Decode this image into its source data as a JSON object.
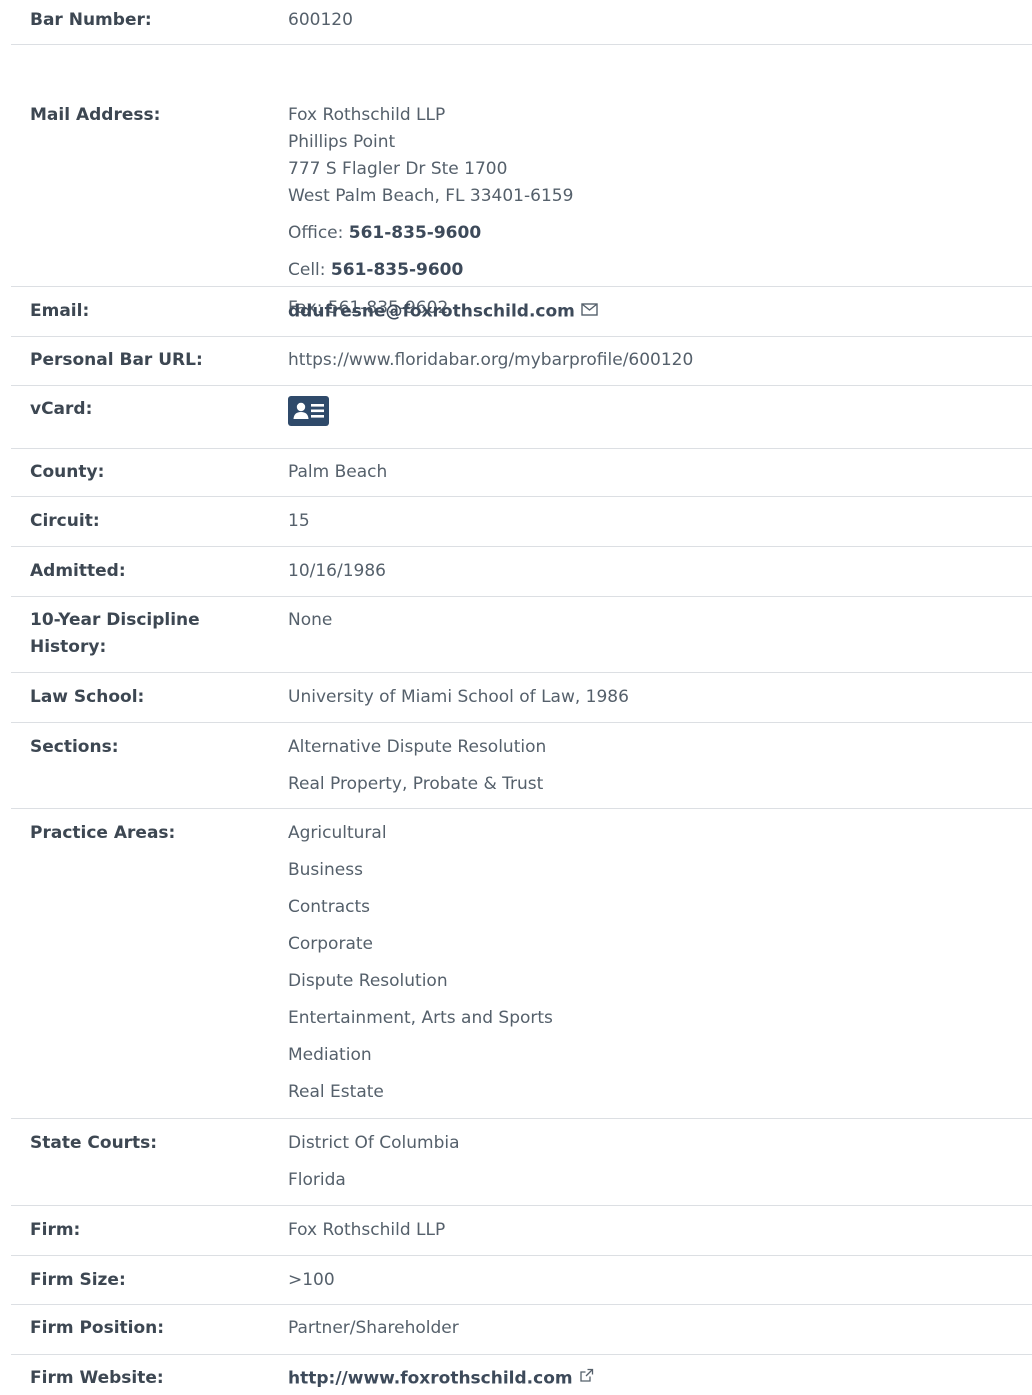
{
  "bar_number": {
    "label": "Bar Number:",
    "value": "600120"
  },
  "mail_address": {
    "label": "Mail Address:",
    "lines": [
      "Fox Rothschild LLP",
      "Phillips Point",
      "777 S Flagler Dr Ste 1700",
      "West Palm Beach, FL 33401-6159"
    ],
    "office_label": "Office: ",
    "office_phone": "561-835-9600",
    "cell_label": "Cell: ",
    "cell_phone": "561-835-9600",
    "fax_label": "Fax: ",
    "fax": "561-835-9602"
  },
  "email": {
    "label": "Email:",
    "value": "ddufresne@foxrothschild.com",
    "icon": "envelope-icon"
  },
  "personal_url": {
    "label": "Personal Bar URL:",
    "value": "https://www.floridabar.org/mybarprofile/600120"
  },
  "vcard": {
    "label": "vCard:",
    "icon": "contact-card-icon"
  },
  "county": {
    "label": "County:",
    "value": "Palm Beach"
  },
  "circuit": {
    "label": "Circuit:",
    "value": "15"
  },
  "admitted": {
    "label": "Admitted:",
    "value": "10/16/1986"
  },
  "discipline": {
    "label_line1": "10-Year Discipline",
    "label_line2": "History:",
    "value": "None"
  },
  "law_school": {
    "label": "Law School:",
    "value": "University of Miami School of Law, 1986"
  },
  "sections": {
    "label": "Sections:",
    "items": [
      "Alternative Dispute Resolution",
      "Real Property, Probate & Trust"
    ]
  },
  "practice_areas": {
    "label": "Practice Areas:",
    "items": [
      "Agricultural",
      "Business",
      "Contracts",
      "Corporate",
      "Dispute Resolution",
      "Entertainment, Arts and Sports",
      "Mediation",
      "Real Estate"
    ]
  },
  "state_courts": {
    "label": "State Courts:",
    "items": [
      "District Of Columbia",
      "Florida"
    ]
  },
  "firm": {
    "label": "Firm:",
    "value": "Fox Rothschild LLP"
  },
  "firm_size": {
    "label": "Firm Size:",
    "value": ">100"
  },
  "firm_position": {
    "label": "Firm Position:",
    "value": "Partner/Shareholder"
  },
  "firm_website": {
    "label": "Firm Website:",
    "value": "http://www.foxrothschild.com",
    "icon": "external-link-icon"
  },
  "colors": {
    "link": "#3d4a5a",
    "text": "#55606b",
    "label": "#3d4752",
    "divider": "#dcdfe3",
    "vcard_bg": "#2f4a6a"
  }
}
